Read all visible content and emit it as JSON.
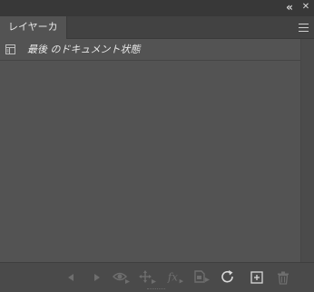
{
  "window": {
    "collapse_glyph": "«",
    "close_glyph": "✕"
  },
  "tabs": [
    {
      "label": "レイヤーカンプ"
    }
  ],
  "list": {
    "items": [
      {
        "label": "最後 のドキュメント状態",
        "icon": "document-state-icon"
      }
    ]
  },
  "toolbar": {
    "buttons": [
      {
        "name": "previous-comp-button",
        "icon": "triangle-left-icon"
      },
      {
        "name": "next-comp-button",
        "icon": "triangle-right-icon"
      },
      {
        "name": "visibility-button",
        "icon": "eye-icon"
      },
      {
        "name": "position-button",
        "icon": "move-icon"
      },
      {
        "name": "layer-style-button",
        "icon": "fx-icon"
      },
      {
        "name": "smart-object-button",
        "icon": "document-arrow-icon"
      },
      {
        "name": "update-comp-button",
        "icon": "refresh-icon"
      },
      {
        "name": "new-comp-button",
        "icon": "new-layer-icon"
      },
      {
        "name": "delete-comp-button",
        "icon": "trash-icon"
      }
    ]
  },
  "colors": {
    "panel_bg": "#535353",
    "tab_bar_bg": "#424242",
    "top_strip_bg": "#383838",
    "icon_active": "#d9d9d9",
    "icon_disabled": "#6e6e6e",
    "text": "#e6e6e6"
  }
}
